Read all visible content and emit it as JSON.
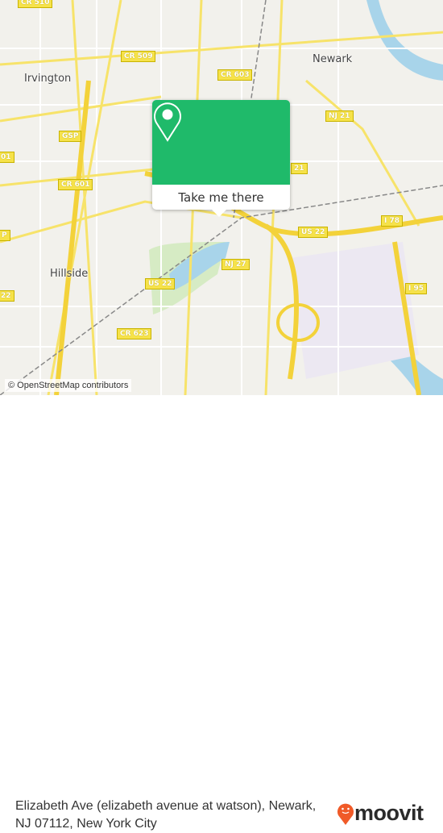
{
  "map": {
    "places": [
      {
        "name": "Newark"
      },
      {
        "name": "Irvington"
      },
      {
        "name": "Hillside"
      }
    ],
    "shields": [
      "CR 510",
      "CR 509",
      "CR 603",
      "NJ 21",
      "21",
      "GSP",
      "01",
      "CR 601",
      "P",
      "I 78",
      "US 22",
      "NJ 27",
      "US 22",
      "22",
      "I 95",
      "CR 623"
    ],
    "attribution": "© OpenStreetMap contributors",
    "colors": {
      "land": "#f2f1ec",
      "road": "#f7e36a",
      "water": "#a8d4ea",
      "park": "#d6ebc4",
      "accent": "#1fba6a"
    }
  },
  "popup": {
    "icon": "map-pin-icon",
    "button_label": "Take me there"
  },
  "footer": {
    "address": "Elizabeth Ave (elizabeth avenue at watson), Newark, NJ 07112, New York City",
    "brand": "moovit",
    "brand_color": "#f05a28"
  }
}
